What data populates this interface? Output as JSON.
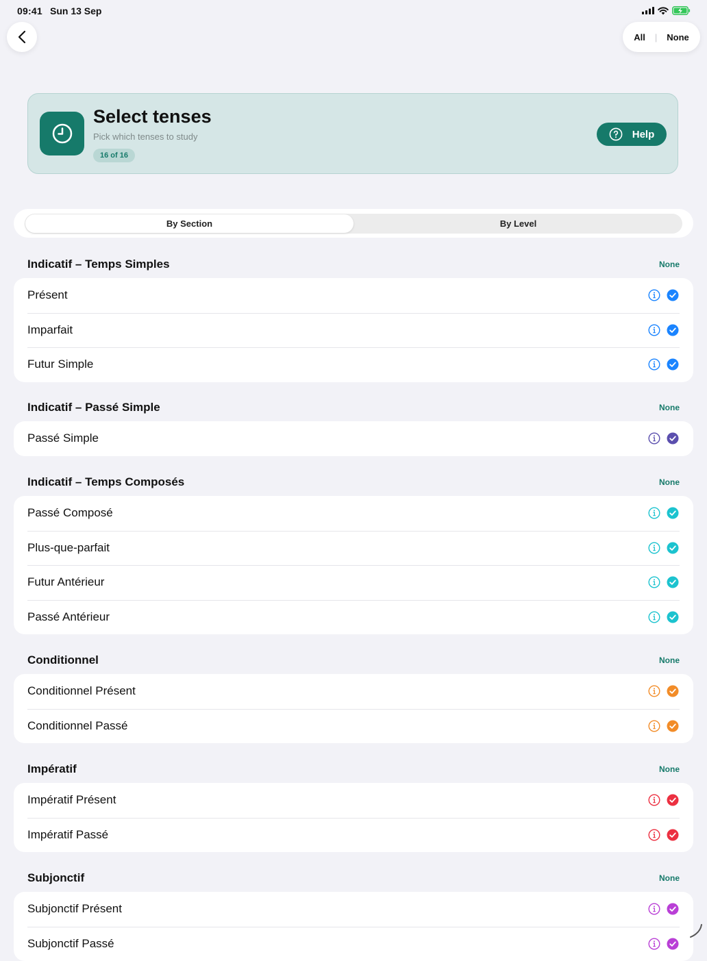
{
  "status": {
    "time": "09:41",
    "date": "Sun 13 Sep"
  },
  "top": {
    "all_label": "All",
    "none_label": "None"
  },
  "header": {
    "title": "Select tenses",
    "subtitle": "Pick which tenses to study",
    "badge": "16 of 16",
    "help_label": "Help"
  },
  "tabs": [
    {
      "label": "By Section",
      "active": true
    },
    {
      "label": "By Level",
      "active": false
    }
  ],
  "section_action": "None",
  "sections": [
    {
      "title": "Indicatif – Temps Simples",
      "color": "#1a84ff",
      "items": [
        "Présent",
        "Imparfait",
        "Futur Simple"
      ]
    },
    {
      "title": "Indicatif – Passé Simple",
      "color": "#5b4fae",
      "items": [
        "Passé Simple"
      ]
    },
    {
      "title": "Indicatif – Temps Composés",
      "color": "#1cc3cf",
      "items": [
        "Passé Composé",
        "Plus-que-parfait",
        "Futur Antérieur",
        "Passé Antérieur"
      ]
    },
    {
      "title": "Conditionnel",
      "color": "#f28c28",
      "items": [
        "Conditionnel Présent",
        "Conditionnel Passé"
      ]
    },
    {
      "title": "Impératif",
      "color": "#ec3041",
      "items": [
        "Impératif Présent",
        "Impératif Passé"
      ]
    },
    {
      "title": "Subjonctif",
      "color": "#b93fd6",
      "items": [
        "Subjonctif Présent",
        "Subjonctif Passé"
      ]
    }
  ],
  "colors": {
    "accent": "#167a6a",
    "header_bg": "#d5e6e6",
    "page_bg": "#f2f2f7"
  },
  "icons": {
    "back": "chevron-left-icon",
    "header": "clock-icon",
    "help": "question-circle-icon",
    "info": "info-circle-icon",
    "check": "checkmark-circle-icon"
  }
}
